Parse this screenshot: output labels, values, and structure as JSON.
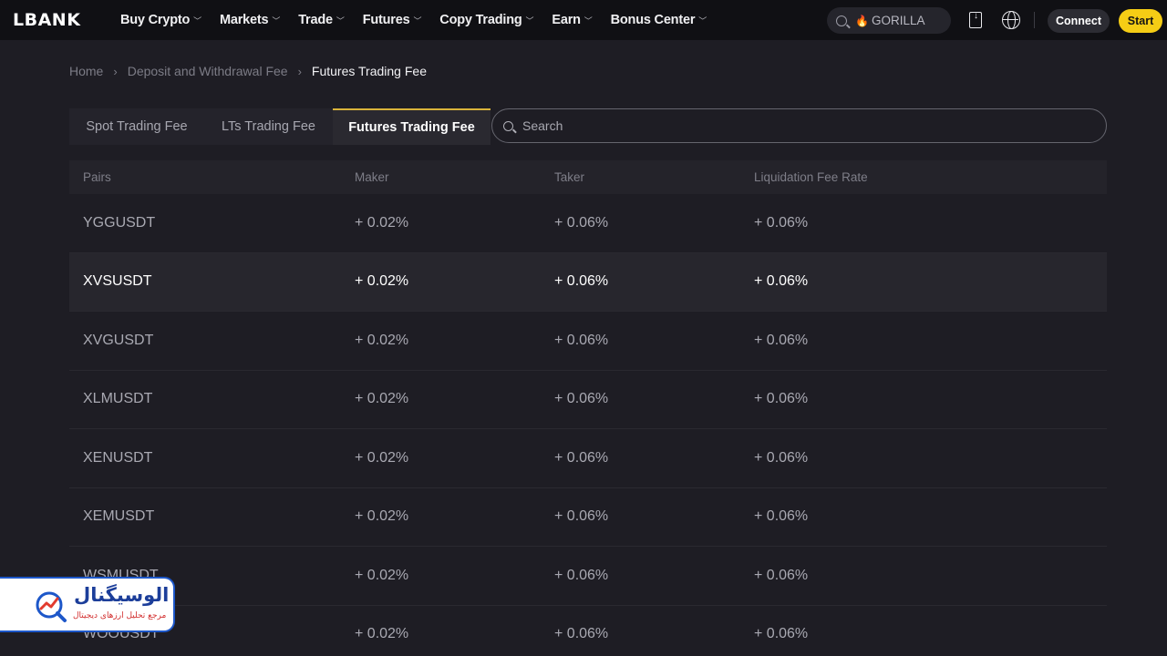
{
  "brand": {
    "logo_text": "LBANK"
  },
  "nav": {
    "menu": [
      {
        "label": "Buy Crypto"
      },
      {
        "label": "Markets"
      },
      {
        "label": "Trade"
      },
      {
        "label": "Futures"
      },
      {
        "label": "Copy Trading"
      },
      {
        "label": "Earn"
      },
      {
        "label": "Bonus Center"
      }
    ],
    "search_keyword": "GORILLA",
    "connect_label": "Connect",
    "start_label": "Start"
  },
  "breadcrumb": [
    "Home",
    "Deposit and Withdrawal Fee",
    "Futures Trading Fee"
  ],
  "tabs": [
    {
      "label": "Spot Trading Fee"
    },
    {
      "label": "LTs Trading Fee"
    },
    {
      "label": "Futures Trading Fee",
      "active": true
    }
  ],
  "search": {
    "placeholder": "Search"
  },
  "table": {
    "headers": [
      "Pairs",
      "Maker",
      "Taker",
      "Liquidation Fee Rate"
    ],
    "rows": [
      {
        "pair": "YGGUSDT",
        "maker": "+ 0.02%",
        "taker": "+ 0.06%",
        "liq": "+ 0.06%"
      },
      {
        "pair": "XVSUSDT",
        "maker": "+ 0.02%",
        "taker": "+ 0.06%",
        "liq": "+ 0.06%",
        "highlighted": true
      },
      {
        "pair": "XVGUSDT",
        "maker": "+ 0.02%",
        "taker": "+ 0.06%",
        "liq": "+ 0.06%"
      },
      {
        "pair": "XLMUSDT",
        "maker": "+ 0.02%",
        "taker": "+ 0.06%",
        "liq": "+ 0.06%"
      },
      {
        "pair": "XENUSDT",
        "maker": "+ 0.02%",
        "taker": "+ 0.06%",
        "liq": "+ 0.06%"
      },
      {
        "pair": "XEMUSDT",
        "maker": "+ 0.02%",
        "taker": "+ 0.06%",
        "liq": "+ 0.06%"
      },
      {
        "pair": "WSMUSDT",
        "maker": "+ 0.02%",
        "taker": "+ 0.06%",
        "liq": "+ 0.06%"
      },
      {
        "pair": "WOOUSDT",
        "maker": "+ 0.02%",
        "taker": "+ 0.06%",
        "liq": "+ 0.06%"
      }
    ]
  },
  "watermark": {
    "title": "الوسیگنال",
    "subtitle": "مرجع تحلیل ارزهای دیجیتال"
  },
  "colors": {
    "accent": "#f5cd15",
    "tab_underline": "#d9b33a",
    "background": "#1e1d24",
    "nav_bg": "#101014"
  }
}
